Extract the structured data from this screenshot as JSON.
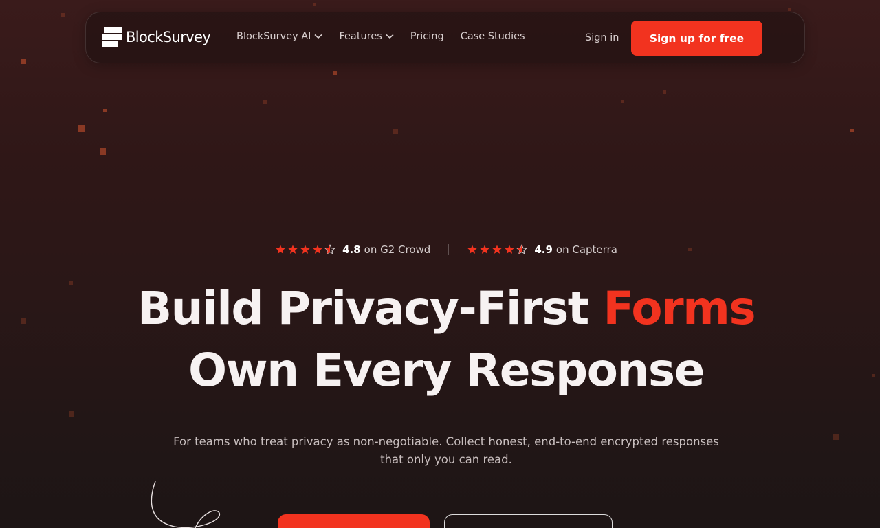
{
  "brand": {
    "name": "BlockSurvey"
  },
  "nav": {
    "links": [
      {
        "label": "BlockSurvey AI",
        "has_dropdown": true
      },
      {
        "label": "Features",
        "has_dropdown": true
      },
      {
        "label": "Pricing",
        "has_dropdown": false
      },
      {
        "label": "Case Studies",
        "has_dropdown": false
      }
    ],
    "signin_label": "Sign in",
    "signup_label": "Sign up for free"
  },
  "ratings": [
    {
      "score": "4.8",
      "source": "on G2 Crowd",
      "stars": 4.5
    },
    {
      "score": "4.9",
      "source": "on Capterra",
      "stars": 4.5
    }
  ],
  "hero": {
    "headline_line1_main": "Build Privacy-First",
    "headline_line1_accent": "Forms",
    "headline_line2": "Own Every Response",
    "subtitle": "For teams who treat privacy as non-negotiable. Collect honest, end-to-end encrypted responses that only you can read."
  },
  "colors": {
    "accent": "#f2331f",
    "background_top": "#3a1b1b",
    "background_bottom": "#1d1515",
    "text_primary": "#f7f2f2",
    "text_muted": "#c8bebe"
  },
  "icons": {
    "star": "star-icon",
    "half_star": "half-star-icon",
    "dropdown": "chevron-down-icon",
    "logo": "blocksurvey-logo-icon"
  }
}
